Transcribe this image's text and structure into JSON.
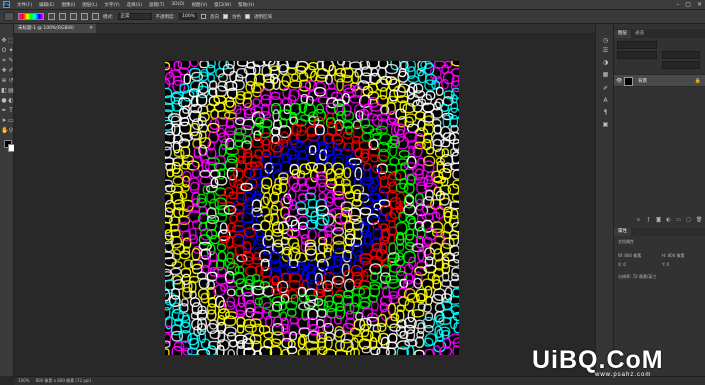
{
  "app": {
    "logo": "Ps",
    "menu": [
      "文件(F)",
      "编辑(E)",
      "图像(I)",
      "图层(L)",
      "文字(Y)",
      "选择(S)",
      "滤镜(T)",
      "3D(D)",
      "视图(V)",
      "窗口(W)",
      "帮助(H)"
    ],
    "window_controls": [
      "–",
      "▢",
      "✕"
    ]
  },
  "options_bar": {
    "mode_label": "模式:",
    "mode_value": "正常",
    "opacity_label": "不透明度:",
    "opacity_value": "100%",
    "reverse_label": "反向",
    "dither_label": "仿色",
    "transparency_label": "透明区域",
    "gradient_colors": [
      "#ff00ff",
      "#ff0000",
      "#ffff00",
      "#00ff00",
      "#00ffff",
      "#0000ff"
    ]
  },
  "document": {
    "tab_title": "未标题-1 @ 100%(RGB/8)",
    "tab_close": "✕",
    "canvas_background": "#000000"
  },
  "tools": {
    "icons": [
      "move-tool-icon",
      "marquee-tool-icon",
      "lasso-tool-icon",
      "magic-wand-icon",
      "crop-tool-icon",
      "eyedropper-icon",
      "healing-brush-icon",
      "brush-tool-icon",
      "clone-stamp-icon",
      "history-brush-icon",
      "eraser-icon",
      "gradient-tool-icon",
      "blur-tool-icon",
      "dodge-tool-icon",
      "pen-tool-icon",
      "type-tool-icon",
      "path-select-icon",
      "shape-tool-icon",
      "hand-tool-icon",
      "zoom-tool-icon"
    ],
    "glyphs": [
      "✥",
      "⬚",
      "ʘ",
      "✦",
      "⌗",
      "✎",
      "✚",
      "✐",
      "⊕",
      "↺",
      "◧",
      "▤",
      "●",
      "◐",
      "✒",
      "T",
      "➤",
      "▭",
      "✋",
      "⚲"
    ],
    "foreground_color": "#000000",
    "background_color": "#ffffff"
  },
  "panels": {
    "layers_tabs": [
      "图层",
      "通道"
    ],
    "layer_name": "背景",
    "properties_title": "属性",
    "properties_sub": "文档属性",
    "prop_w_label": "W: 800 像素",
    "prop_h_label": "H: 800 像素",
    "prop_x_label": "X: 0",
    "prop_y_label": "Y: 0",
    "resolution_label": "分辨率: 72 像素/英寸"
  },
  "status": {
    "zoom": "100%",
    "doc_info": "800 像素 x 800 像素 (72 ppi)"
  },
  "watermark": {
    "brand": "UiBQ.CoM",
    "url": "www.psahz.com"
  }
}
